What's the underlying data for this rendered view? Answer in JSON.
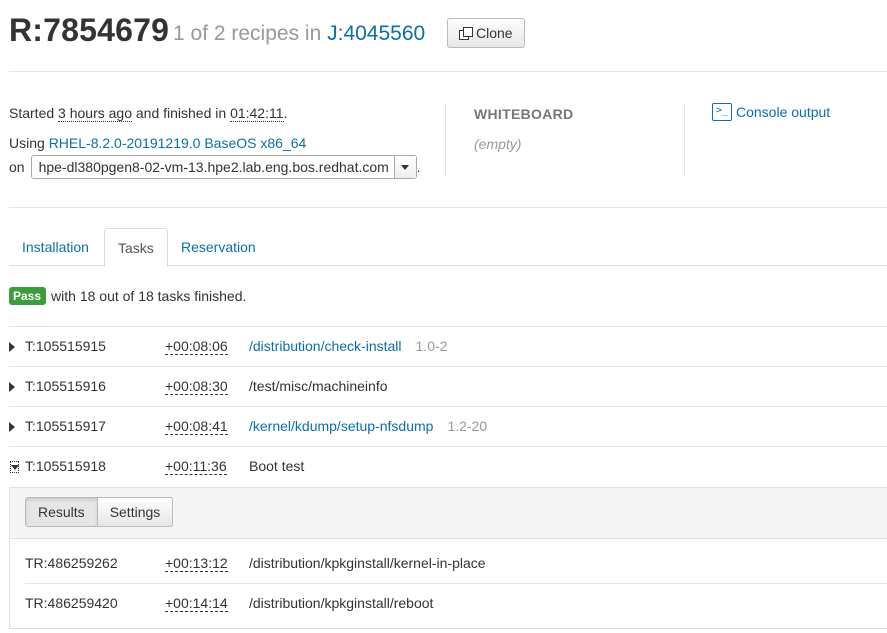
{
  "header": {
    "title": "R:7854679",
    "subtitle_prefix": "1 of 2 recipes in",
    "job_link": "J:4045560",
    "clone_label": "Clone"
  },
  "info": {
    "started_prefix": "Started",
    "started_ago": "3 hours ago",
    "finished_mid": "and finished in",
    "duration": "01:42:11",
    "period": ".",
    "using_prefix": "Using",
    "distro": "RHEL-8.2.0-20191219.0 BaseOS x86_64",
    "on_prefix": "on",
    "system": "hpe-dl380pgen8-02-vm-13.hpe2.lab.eng.bos.redhat.com",
    "trailing_dot": ".",
    "whiteboard_label": "WHITEBOARD",
    "whiteboard_value": "(empty)",
    "console_label": "Console output"
  },
  "tabs": [
    {
      "label": "Installation",
      "active": false
    },
    {
      "label": "Tasks",
      "active": true
    },
    {
      "label": "Reservation",
      "active": false
    }
  ],
  "status": {
    "badge": "Pass",
    "text": "with 18 out of 18 tasks finished."
  },
  "tasks": [
    {
      "id": "T:105515915",
      "duration": "+00:08:06",
      "name": "/distribution/check-install",
      "version": "1.0-2",
      "linked": true,
      "expanded": false
    },
    {
      "id": "T:105515916",
      "duration": "+00:08:30",
      "name": "/test/misc/machineinfo",
      "version": "",
      "linked": false,
      "expanded": false
    },
    {
      "id": "T:105515917",
      "duration": "+00:08:41",
      "name": "/kernel/kdump/setup-nfsdump",
      "version": "1.2-20",
      "linked": true,
      "expanded": false
    },
    {
      "id": "T:105515918",
      "duration": "+00:11:36",
      "name": "Boot test",
      "version": "",
      "linked": false,
      "expanded": true
    }
  ],
  "result_panel": {
    "buttons": [
      "Results",
      "Settings"
    ],
    "results": [
      {
        "id": "TR:486259262",
        "duration": "+00:13:12",
        "name": "/distribution/kpkginstall/kernel-in-place"
      },
      {
        "id": "TR:486259420",
        "duration": "+00:14:14",
        "name": "/distribution/kpkginstall/reboot"
      }
    ]
  },
  "colors": {
    "link": "#0d6fa8",
    "pass": "#3d9d3d",
    "muted": "#999999"
  }
}
